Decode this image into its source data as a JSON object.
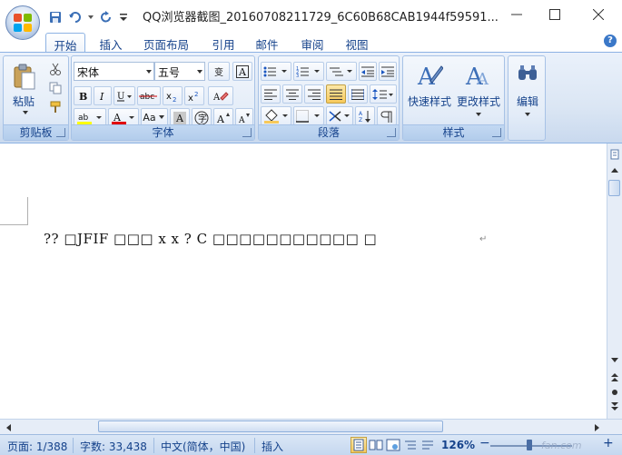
{
  "window": {
    "title": "QQ浏览器截图_20160708211729_6C60B68CAB1944f59591...",
    "minimize_icon": "minimize-icon",
    "maximize_icon": "maximize-icon",
    "close_icon": "close-icon"
  },
  "tabs": [
    "开始",
    "插入",
    "页面布局",
    "引用",
    "邮件",
    "审阅",
    "视图"
  ],
  "active_tab": "开始",
  "ribbon": {
    "clipboard": {
      "label": "剪贴板",
      "paste_label": "粘贴"
    },
    "font": {
      "label": "字体",
      "font_name": "宋体",
      "font_size": "五号",
      "wen_label": "变",
      "aa_label": "Aa"
    },
    "paragraph": {
      "label": "段落"
    },
    "styles": {
      "label": "样式",
      "quick_label": "快速样式",
      "change_label": "更改样式"
    },
    "editing": {
      "label": "编辑"
    }
  },
  "document": {
    "line": "?? □JFIF □□□ x x   ? C □□□□□□□□□□□     □",
    "para_mark": "↵"
  },
  "statusbar": {
    "page": "页面: 1/388",
    "words": "字数: 33,438",
    "language": "中文(简体，中国)",
    "mode": "插入",
    "zoom": "126%",
    "zoom_minus": "−",
    "zoom_plus": "+"
  },
  "watermark": "fan.com",
  "colors": {
    "accent": "#15428b",
    "ribbon": "#dbe6f4",
    "highlight": "#f7c95b"
  }
}
